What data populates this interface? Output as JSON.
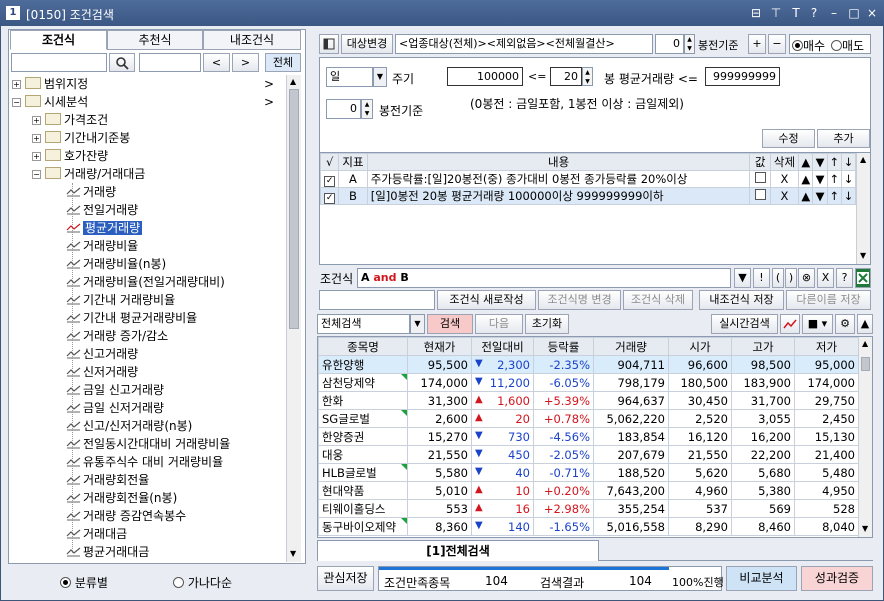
{
  "window": {
    "number": "1",
    "title": "[0150] 조건검색",
    "buttons": [
      "⊟",
      "⊤",
      "T",
      "?",
      "–",
      "□",
      "×"
    ]
  },
  "left": {
    "tabs": [
      "조건식",
      "추천식",
      "내조건식"
    ],
    "search_input": "",
    "search_input2": "",
    "prev": "<",
    "next": ">",
    "all_button": "전체",
    "tree": [
      {
        "label": "범위지정",
        "level": 0,
        "kind": "folder",
        "expander": "+",
        "arrow": ">"
      },
      {
        "label": "시세분석",
        "level": 0,
        "kind": "folder",
        "expander": "−",
        "arrow": ">"
      },
      {
        "label": "가격조건",
        "level": 1,
        "kind": "folder",
        "expander": "+"
      },
      {
        "label": "기간내기준봉",
        "level": 1,
        "kind": "folder",
        "expander": "+"
      },
      {
        "label": "호가잔량",
        "level": 1,
        "kind": "folder",
        "expander": "+"
      },
      {
        "label": "거래량/거래대금",
        "level": 1,
        "kind": "folder",
        "expander": "−"
      },
      {
        "label": "거래량",
        "level": 2,
        "kind": "item"
      },
      {
        "label": "전일거래량",
        "level": 2,
        "kind": "item"
      },
      {
        "label": "평균거래량",
        "level": 2,
        "kind": "item",
        "selected": true
      },
      {
        "label": "거래량비율",
        "level": 2,
        "kind": "item"
      },
      {
        "label": "거래량비율(n봉)",
        "level": 2,
        "kind": "item"
      },
      {
        "label": "거래량비율(전일거래량대비)",
        "level": 2,
        "kind": "item"
      },
      {
        "label": "기간내 거래량비율",
        "level": 2,
        "kind": "item"
      },
      {
        "label": "기간내 평균거래량비율",
        "level": 2,
        "kind": "item"
      },
      {
        "label": "거래량 증가/감소",
        "level": 2,
        "kind": "item"
      },
      {
        "label": "신고거래량",
        "level": 2,
        "kind": "item"
      },
      {
        "label": "신저거래량",
        "level": 2,
        "kind": "item"
      },
      {
        "label": "금일 신고거래량",
        "level": 2,
        "kind": "item"
      },
      {
        "label": "금일 신저거래량",
        "level": 2,
        "kind": "item"
      },
      {
        "label": "신고/신저거래량(n봉)",
        "level": 2,
        "kind": "item"
      },
      {
        "label": "전일동시간대대비 거래량비율",
        "level": 2,
        "kind": "item"
      },
      {
        "label": "유통주식수 대비 거래량비율",
        "level": 2,
        "kind": "item"
      },
      {
        "label": "거래량회전율",
        "level": 2,
        "kind": "item"
      },
      {
        "label": "거래량회전율(n봉)",
        "level": 2,
        "kind": "item"
      },
      {
        "label": "거래량 증감연속봉수",
        "level": 2,
        "kind": "item"
      },
      {
        "label": "거래대금",
        "level": 2,
        "kind": "item"
      },
      {
        "label": "평균거래대금",
        "level": 2,
        "kind": "item"
      }
    ],
    "radio_category": "분류별",
    "radio_alpha": "가나다순"
  },
  "top": {
    "target_change": "대상변경",
    "target_value": "<업종대상(전체)><제외없음><전체월결산>",
    "bong_value": "0",
    "bong_label": "봉전기준",
    "plus": "+",
    "minus": "−",
    "buy": "매수",
    "sell": "매도"
  },
  "param": {
    "period_value": "일",
    "period_label": "주기",
    "bong_value": "0",
    "bong_label": "봉전기준",
    "min_value": "100000",
    "lte": "<=",
    "n_value": "20",
    "avg_label": "봉 평균거래량 <=",
    "max_value": "999999999",
    "note": "(0봉전 : 금일포함, 1봉전 이상 : 금일제외)",
    "modify": "수정",
    "add": "추가"
  },
  "conditions": {
    "headers": [
      "√",
      "지표",
      "내용",
      "값",
      "삭제",
      "▲",
      "▼",
      "↑",
      "↓"
    ],
    "rows": [
      {
        "id": "A",
        "content": "주가등락률:[일]20봉전(중) 종가대비 0봉전 종가등락률 20%이상",
        "del": "X",
        "up": "▲",
        "down": "▼",
        "top": "↑",
        "bottom": "↓"
      },
      {
        "id": "B",
        "content": "[일]0봉전 20봉 평균거래량 100000이상 999999999이하",
        "del": "X",
        "up": "▲",
        "down": "▼",
        "top": "↑",
        "bottom": "↓"
      }
    ]
  },
  "formula": {
    "label": "조건식",
    "value_a": "A",
    "value_and": "and",
    "value_b": "B",
    "ops": [
      "▼",
      "!",
      "(",
      ")",
      "⊗",
      "X",
      "?"
    ]
  },
  "actions": {
    "new": "조건식 새로작성",
    "rename": "조건식명 변경",
    "delete": "조건식 삭제",
    "save": "내조건식 저장",
    "save_as": "다른이름 저장"
  },
  "search_bar": {
    "scope": "전체검색",
    "search": "검색",
    "next": "다음",
    "reset": "초기화",
    "realtime": "실시간검색"
  },
  "results": {
    "headers": [
      "종목명",
      "현재가",
      "전일대비",
      "등락률",
      "거래량",
      "시가",
      "고가",
      "저가"
    ],
    "rows": [
      {
        "name": "유한양행",
        "price": "95,500",
        "dir": "dn",
        "change": "2,300",
        "rate": "-2.35%",
        "volume": "904,711",
        "open": "96,600",
        "high": "98,500",
        "low": "95,000",
        "mark": false,
        "highlight": true
      },
      {
        "name": "삼천당제약",
        "price": "174,000",
        "dir": "dn",
        "change": "11,200",
        "rate": "-6.05%",
        "volume": "798,179",
        "open": "180,500",
        "high": "183,900",
        "low": "174,000",
        "mark": true
      },
      {
        "name": "한화",
        "price": "31,300",
        "dir": "up",
        "change": "1,600",
        "rate": "+5.39%",
        "volume": "964,637",
        "open": "30,450",
        "high": "31,700",
        "low": "29,750",
        "mark": false
      },
      {
        "name": "SG글로벌",
        "price": "2,600",
        "dir": "up",
        "change": "20",
        "rate": "+0.78%",
        "volume": "5,062,220",
        "open": "2,520",
        "high": "3,055",
        "low": "2,450",
        "mark": true
      },
      {
        "name": "한양증권",
        "price": "15,270",
        "dir": "dn",
        "change": "730",
        "rate": "-4.56%",
        "volume": "183,854",
        "open": "16,120",
        "high": "16,200",
        "low": "15,130",
        "mark": false
      },
      {
        "name": "대웅",
        "price": "21,550",
        "dir": "dn",
        "change": "450",
        "rate": "-2.05%",
        "volume": "207,679",
        "open": "21,550",
        "high": "22,200",
        "low": "21,400",
        "mark": false
      },
      {
        "name": "HLB글로벌",
        "price": "5,580",
        "dir": "dn",
        "change": "40",
        "rate": "-0.71%",
        "volume": "188,520",
        "open": "5,620",
        "high": "5,680",
        "low": "5,480",
        "mark": true
      },
      {
        "name": "현대약품",
        "price": "5,010",
        "dir": "up",
        "change": "10",
        "rate": "+0.20%",
        "volume": "7,643,200",
        "open": "4,960",
        "high": "5,380",
        "low": "4,950",
        "mark": false
      },
      {
        "name": "티웨이홀딩스",
        "price": "553",
        "dir": "up",
        "change": "16",
        "rate": "+2.98%",
        "volume": "355,254",
        "open": "537",
        "high": "569",
        "low": "528",
        "mark": false
      },
      {
        "name": "동구바이오제약",
        "price": "8,360",
        "dir": "dn",
        "change": "140",
        "rate": "-1.65%",
        "volume": "5,016,558",
        "open": "8,290",
        "high": "8,460",
        "low": "8,040",
        "mark": true
      }
    ]
  },
  "bottom_tab": "[1]전체검색",
  "status": {
    "watch_save": "관심저장",
    "satisfied_label": "조건만족종목",
    "satisfied_count": "104",
    "result_label": "검색결과",
    "result_count": "104",
    "progress": "100%진행",
    "compare": "비교분석",
    "verify": "성과검증"
  },
  "colors": {
    "up": "#d2161e",
    "down": "#1b43c9",
    "title": "#3b5784",
    "search_button": "#f8c9c9",
    "compare": "#cfe3f7"
  }
}
